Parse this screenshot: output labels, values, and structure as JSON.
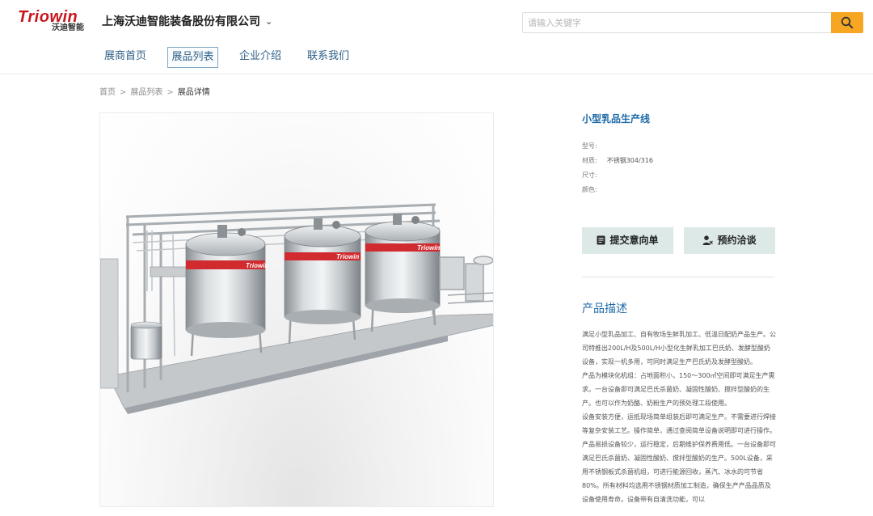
{
  "header": {
    "logo_word": "Triowin",
    "logo_sub": "沃迪智能",
    "company": "上海沃迪智能装备股份有限公司",
    "search": {
      "placeholder": "请输入关键字"
    }
  },
  "nav": [
    {
      "label": "展商首页"
    },
    {
      "label": "展品列表",
      "active": true
    },
    {
      "label": "企业介绍"
    },
    {
      "label": "联系我们"
    }
  ],
  "breadcrumb": {
    "home": "首页",
    "list": "展品列表",
    "current": "展品详情",
    "separator": ">"
  },
  "product": {
    "image_brand": "Triowin",
    "title": "小型乳品生产线",
    "specs": [
      {
        "label": "型号:",
        "value": ""
      },
      {
        "label": "材质:",
        "value": "不锈钢304/316"
      },
      {
        "label": "尺寸:",
        "value": ""
      },
      {
        "label": "颜色:",
        "value": ""
      }
    ]
  },
  "actions": {
    "submit_intent": "提交意向单",
    "book_meeting": "预约洽谈"
  },
  "description": {
    "title": "产品描述",
    "paragraphs": [
      "满足小型乳品加工、自有牧场生鲜乳加工、低温日配奶产品生产。公司特推出200L/H及500L/H小型化生鲜乳加工巴氏奶、发酵型酸奶设备，实现一机多用，可同时满足生产巴氏奶及发酵型酸奶。",
      "产品为模块化机组：占地面积小，150～300㎡空间即可满足生产需求。一台设备即可满足巴氏杀菌奶、凝固性酸奶、搅拌型酸奶的生产。也可以作为奶酪、奶粉生产的预处理工段使用。",
      "设备安装方便，运抵现场简单组装后即可满足生产。不需要进行焊接等复杂安装工艺。操作简单，通过查阅简单设备说明即可进行操作。产品易损设备较少，运行稳定，后期维护保养费用低。一台设备即可满足巴氏杀菌奶、凝固性酸奶、搅拌型酸奶的生产。500L设备，采用不锈钢板式杀菌机组，可进行能源回收，蒸汽、冰水的可节省80%。所有材料均选用不锈钢材质加工制造，确保生产产品品质及设备使用寿命。设备带有自清洗功能，可以"
    ]
  },
  "colors": {
    "brand_red": "#c8161d",
    "title_blue": "#1e6aa8",
    "nav_blue": "#2d5f85",
    "search_orange": "#f6a623",
    "button_bg": "#dde9e7"
  },
  "icons": {
    "search": "search-icon",
    "dropdown": "chevron-down-icon",
    "submit": "document-icon",
    "book": "user-meeting-icon"
  }
}
